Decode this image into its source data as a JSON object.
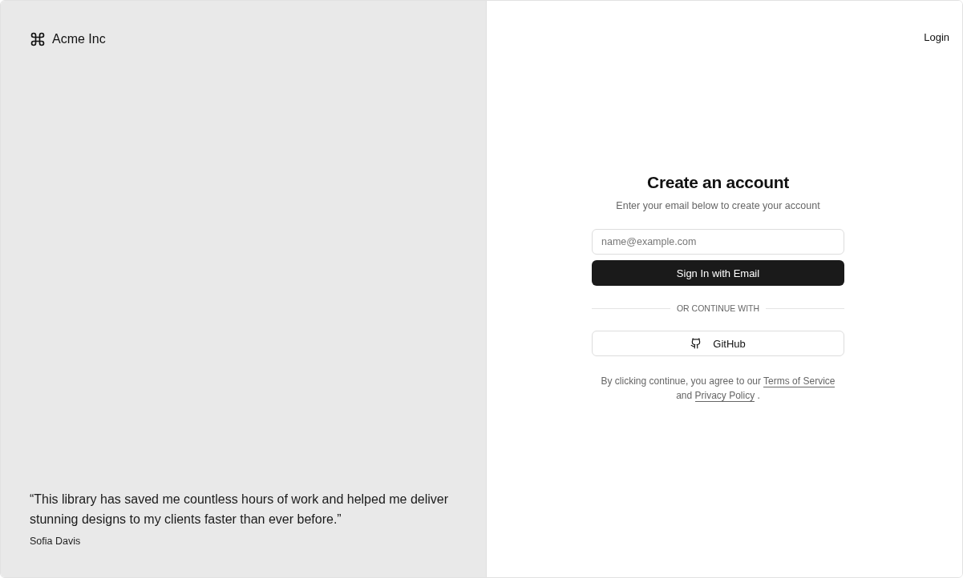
{
  "brand": {
    "name": "Acme Inc"
  },
  "testimonial": {
    "quote": "“This library has saved me countless hours of work and helped me deliver stunning designs to my clients faster than ever before.”",
    "author": "Sofia Davis"
  },
  "header": {
    "login": "Login"
  },
  "form": {
    "title": "Create an account",
    "subtitle": "Enter your email below to create your account",
    "email": {
      "placeholder": "name@example.com"
    },
    "submit": "Sign In with Email",
    "divider": "OR CONTINUE WITH",
    "github": "GitHub"
  },
  "terms": {
    "before": "By clicking continue, you agree to our ",
    "links": [
      "Terms of Service",
      "Privacy Policy"
    ],
    "between": " and ",
    "after": " ."
  }
}
